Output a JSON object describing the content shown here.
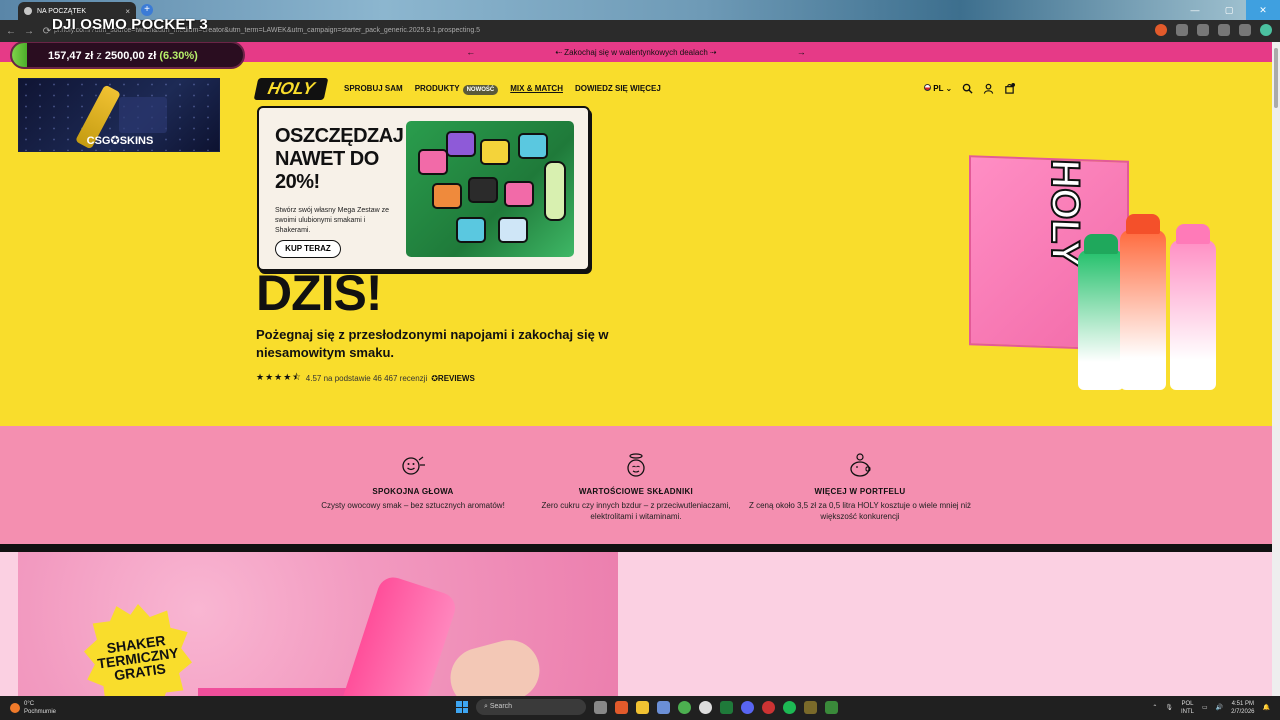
{
  "browser": {
    "tab_title": "NA POCZĄTEK",
    "tab_close": "×",
    "new_tab": "+",
    "overlay_title": "DJI OSMO POCKET 3",
    "url": "pl.holy.com/?utm_source=twitch&utm_medium=creator&utm_term=LAWEK&utm_campaign=starter_pack_generic.2025.9.1.prospecting.5"
  },
  "stream_goal": {
    "current": "157,47 zł",
    "word": "z",
    "target": "2500,00 zł",
    "percent_label": "(6.30%)",
    "progress_percent": 6.3
  },
  "csg_ad": {
    "brand": "CSG✪SKINS"
  },
  "promo_bar": {
    "prev": "←",
    "text": "⇠ Zakochaj się w walentynkowych dealach ⇢",
    "next": "→"
  },
  "header": {
    "logo": "HOLY",
    "nav": [
      {
        "label": "SPROBUJ SAM"
      },
      {
        "label": "PRODUKTY",
        "badge": "NOWOŚĆ"
      },
      {
        "label": "MIX & MATCH"
      },
      {
        "label": "DOWIEDZ SIĘ WIĘCEJ"
      }
    ],
    "lang": "PL",
    "cart_count": "0"
  },
  "dropdown": {
    "title": "OSZCZĘDZAJ NAWET DO 20%!",
    "description": "Stwórz swój własny Mega Zestaw ze swoimi ulubionymi smakami i Shakerami.",
    "button": "KUP TERAZ"
  },
  "hero": {
    "big_text": "DZIS!",
    "subtitle": "Pożegnaj się z przesłodzonymi napojami i zakochaj się w niesamowitym smaku.",
    "stars": "★★★★⯪",
    "rating_text": "4.57 na podstawie 46 467 recenzji",
    "reviews_brand": "✪REVIEWS"
  },
  "features": [
    {
      "icon": "smiley-icon",
      "title": "SPOKOJNA GŁOWA",
      "desc": "Czysty owocowy smak – bez sztucznych aromatów!"
    },
    {
      "icon": "halo-face-icon",
      "title": "WARTOŚCIOWE SKŁADNIKI",
      "desc": "Zero cukru czy innych bzdur – z przeciwutleniaczami, elektrolitami i witaminami."
    },
    {
      "icon": "piggy-bank-icon",
      "title": "WIĘCEJ W PORTFELU",
      "desc": "Z ceną około 3,5 zł za 0,5 litra HOLY kosztuje o wiele mniej niż większość konkurencji"
    }
  ],
  "lower": {
    "badge": "SHAKER TERMICZNY GRATIS"
  },
  "taskbar": {
    "weather_temp": "0°C",
    "weather_desc": "Pochmurnie",
    "search": "Search",
    "lang1": "POL",
    "lang2": "INTL",
    "time": "4:51 PM",
    "date": "2/7/2026"
  },
  "colors": {
    "page_bg": "#f9dd2c",
    "promo": "#e63a87",
    "features_bg": "#f48fb0",
    "lower_bg": "#fbd0e2"
  }
}
